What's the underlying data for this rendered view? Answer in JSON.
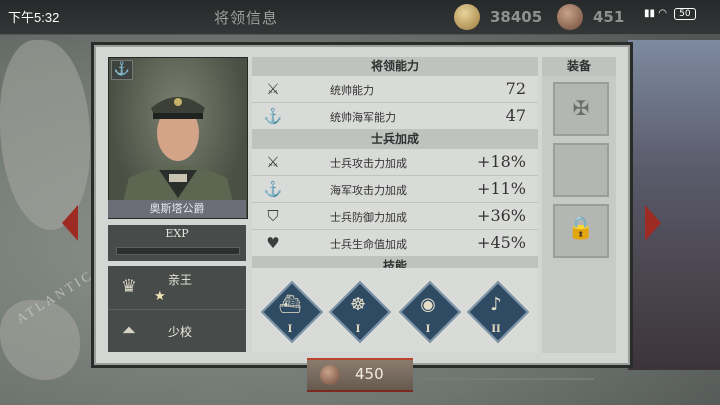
{
  "status_bar": {
    "time": "下午5:32",
    "battery": "50"
  },
  "header": {
    "title": "将领信息"
  },
  "resources": {
    "gold": "38405",
    "medals": "451"
  },
  "general": {
    "name": "奥斯塔公爵",
    "exp_label": "EXP",
    "exp_progress": 0,
    "rank": {
      "title": "亲王",
      "stars": "★"
    },
    "military_rank": "少校"
  },
  "sections": {
    "leadership": "将领能力",
    "troops": "士兵加成",
    "skills": "技能",
    "equipment": "装备"
  },
  "leadership_stats": [
    {
      "icon": "crossed-swords-icon",
      "label": "统帅能力",
      "value": "72"
    },
    {
      "icon": "anchor-icon",
      "label": "统帅海军能力",
      "value": "47"
    }
  ],
  "troop_bonuses": [
    {
      "icon": "sword-badge-icon",
      "label": "士兵攻击力加成",
      "value": "+18%"
    },
    {
      "icon": "anchor-badge-icon",
      "label": "海军攻击力加成",
      "value": "+11%"
    },
    {
      "icon": "shield-badge-icon",
      "label": "士兵防御力加成",
      "value": "+36%"
    },
    {
      "icon": "heart-badge-icon",
      "label": "士兵生命值加成",
      "value": "+45%"
    }
  ],
  "skills": [
    {
      "icon": "battleship-icon",
      "level": "I"
    },
    {
      "icon": "ship-wheel-icon",
      "level": "I"
    },
    {
      "icon": "eye-icon",
      "level": "I"
    },
    {
      "icon": "bugle-icon",
      "level": "II"
    }
  ],
  "cost": {
    "value": "450"
  },
  "map_label": "ATLANTIC OCE"
}
